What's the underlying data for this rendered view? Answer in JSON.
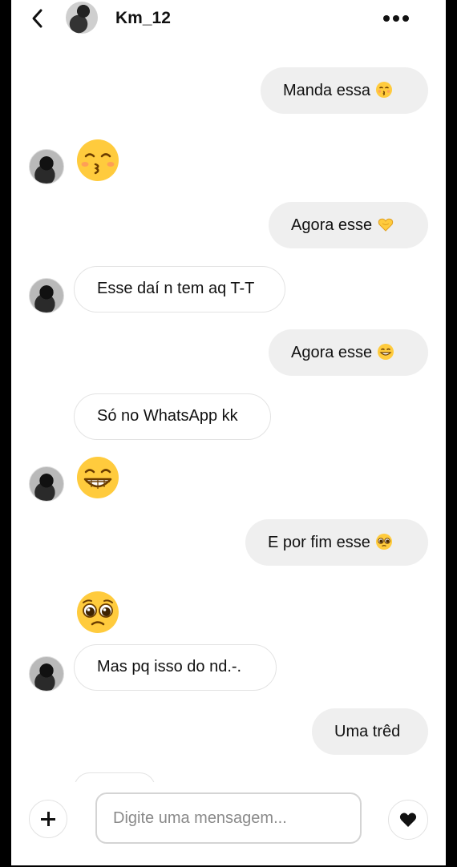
{
  "header": {
    "username": "Km_12"
  },
  "messages": {
    "m1": {
      "text": "Manda essa",
      "emoji": "kissing-face-smiling-eyes"
    },
    "m2": {
      "emoji": "kissing-face-smiling-eyes"
    },
    "m3": {
      "text": "Agora esse",
      "emoji": "heart-hands"
    },
    "m4": {
      "text": "Esse daí n tem aq T-T"
    },
    "m5": {
      "text": "Agora esse",
      "emoji": "grinning-face"
    },
    "m6": {
      "text": "Só no WhatsApp kk"
    },
    "m7": {
      "emoji": "grinning-face"
    },
    "m8": {
      "text": "E por fim esse",
      "emoji": "pleading-face"
    },
    "m9": {
      "emoji": "pleading-face"
    },
    "m10": {
      "text": "Mas pq isso do nd.-."
    },
    "m11": {
      "text": "Uma trêd"
    }
  },
  "composer": {
    "placeholder": "Digite uma mensagem..."
  },
  "colors": {
    "outgoing_bubble": "#efefef",
    "incoming_border": "#e3e3e3",
    "emoji_yellow": "#ffcb3d"
  }
}
